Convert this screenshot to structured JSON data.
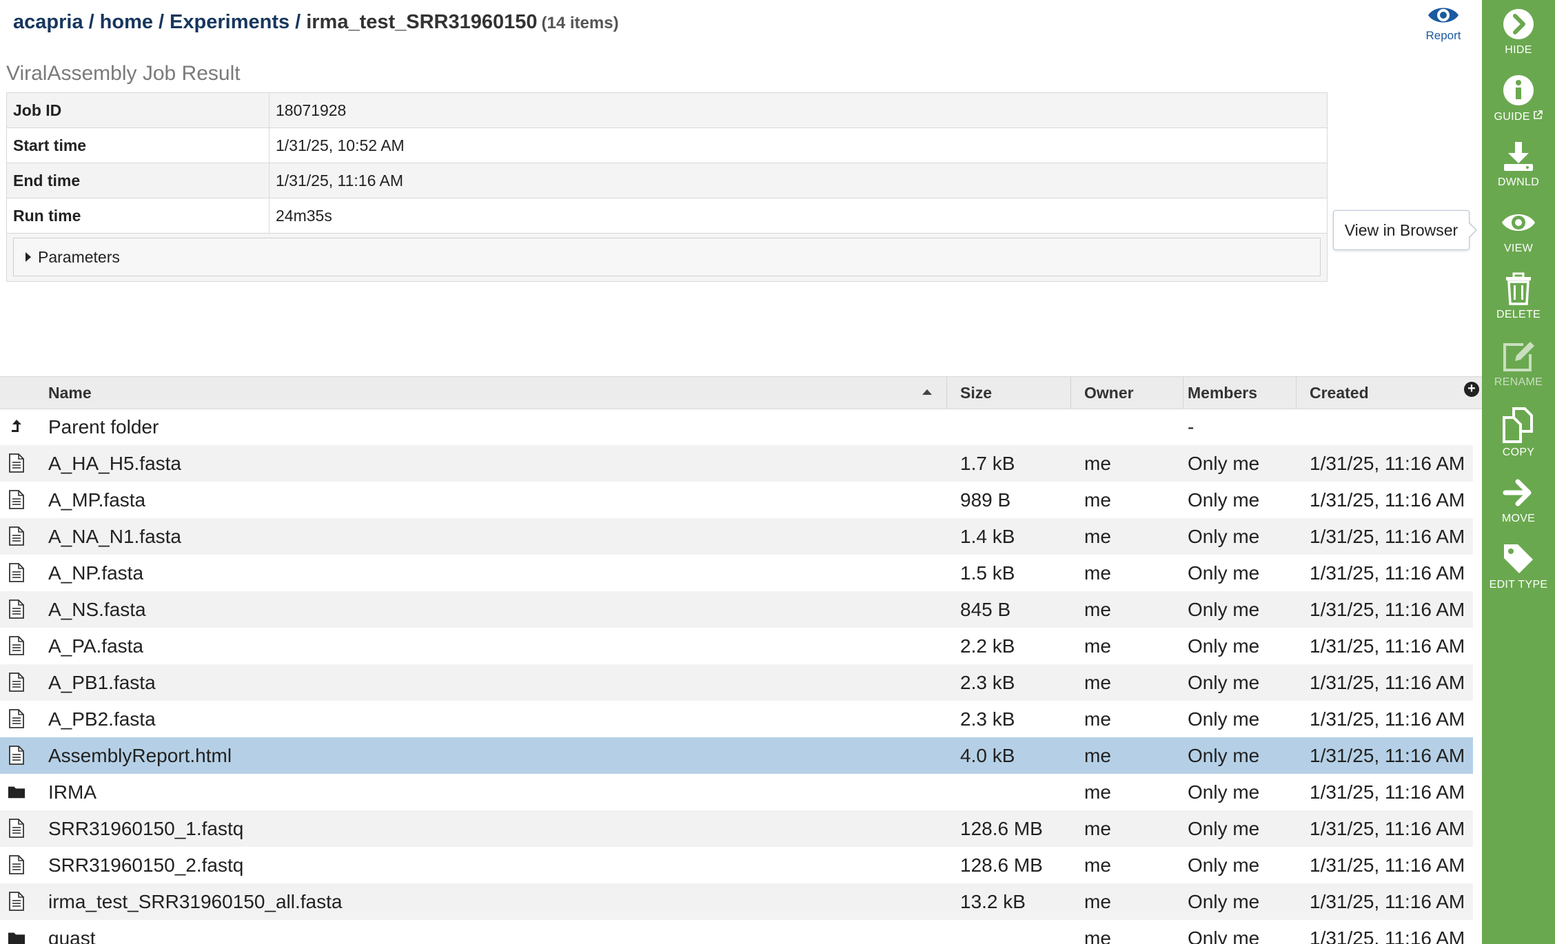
{
  "breadcrumb": {
    "root": "acapria",
    "home": "home",
    "experiments": "Experiments",
    "current": "irma_test_SRR31960150",
    "count": "(14 items)",
    "sep": "/"
  },
  "report_button": {
    "label": "Report"
  },
  "job": {
    "title": "ViralAssembly Job Result",
    "fields": [
      {
        "key": "Job ID",
        "value": "18071928"
      },
      {
        "key": "Start time",
        "value": "1/31/25, 10:52 AM"
      },
      {
        "key": "End time",
        "value": "1/31/25, 11:16 AM"
      },
      {
        "key": "Run time",
        "value": "24m35s"
      }
    ],
    "parameters_label": "Parameters"
  },
  "tooltip": {
    "text": "View in Browser"
  },
  "grid": {
    "columns": {
      "name": "Name",
      "size": "Size",
      "owner": "Owner",
      "members": "Members",
      "created": "Created"
    },
    "add_column_glyph": "+",
    "rows": [
      {
        "icon": "parent",
        "name": "Parent folder",
        "size": "",
        "owner": "",
        "members": "-",
        "created": ""
      },
      {
        "icon": "file",
        "name": "A_HA_H5.fasta",
        "size": "1.7 kB",
        "owner": "me",
        "members": "Only me",
        "created": "1/31/25, 11:16 AM"
      },
      {
        "icon": "file",
        "name": "A_MP.fasta",
        "size": "989 B",
        "owner": "me",
        "members": "Only me",
        "created": "1/31/25, 11:16 AM"
      },
      {
        "icon": "file",
        "name": "A_NA_N1.fasta",
        "size": "1.4 kB",
        "owner": "me",
        "members": "Only me",
        "created": "1/31/25, 11:16 AM"
      },
      {
        "icon": "file",
        "name": "A_NP.fasta",
        "size": "1.5 kB",
        "owner": "me",
        "members": "Only me",
        "created": "1/31/25, 11:16 AM"
      },
      {
        "icon": "file",
        "name": "A_NS.fasta",
        "size": "845 B",
        "owner": "me",
        "members": "Only me",
        "created": "1/31/25, 11:16 AM"
      },
      {
        "icon": "file",
        "name": "A_PA.fasta",
        "size": "2.2 kB",
        "owner": "me",
        "members": "Only me",
        "created": "1/31/25, 11:16 AM"
      },
      {
        "icon": "file",
        "name": "A_PB1.fasta",
        "size": "2.3 kB",
        "owner": "me",
        "members": "Only me",
        "created": "1/31/25, 11:16 AM"
      },
      {
        "icon": "file",
        "name": "A_PB2.fasta",
        "size": "2.3 kB",
        "owner": "me",
        "members": "Only me",
        "created": "1/31/25, 11:16 AM"
      },
      {
        "icon": "file",
        "name": "AssemblyReport.html",
        "size": "4.0 kB",
        "owner": "me",
        "members": "Only me",
        "created": "1/31/25, 11:16 AM",
        "selected": true
      },
      {
        "icon": "folder",
        "name": "IRMA",
        "size": "",
        "owner": "me",
        "members": "Only me",
        "created": "1/31/25, 11:16 AM"
      },
      {
        "icon": "file",
        "name": "SRR31960150_1.fastq",
        "size": "128.6 MB",
        "owner": "me",
        "members": "Only me",
        "created": "1/31/25, 11:16 AM"
      },
      {
        "icon": "file",
        "name": "SRR31960150_2.fastq",
        "size": "128.6 MB",
        "owner": "me",
        "members": "Only me",
        "created": "1/31/25, 11:16 AM"
      },
      {
        "icon": "file",
        "name": "irma_test_SRR31960150_all.fasta",
        "size": "13.2 kB",
        "owner": "me",
        "members": "Only me",
        "created": "1/31/25, 11:16 AM"
      },
      {
        "icon": "folder",
        "name": "quast",
        "size": "",
        "owner": "me",
        "members": "Only me",
        "created": "1/31/25, 11:16 AM"
      }
    ]
  },
  "sidebar": {
    "color": "#6aa84f",
    "buttons": [
      {
        "id": "hide",
        "label": "HIDE",
        "icon": "chevron-right-circle-icon"
      },
      {
        "id": "guide",
        "label": "GUIDE",
        "icon": "info-circle-icon",
        "external": true
      },
      {
        "id": "download",
        "label": "DWNLD",
        "icon": "download-icon"
      },
      {
        "id": "view",
        "label": "VIEW",
        "icon": "eye-icon"
      },
      {
        "id": "delete",
        "label": "DELETE",
        "icon": "trash-icon"
      },
      {
        "id": "rename",
        "label": "RENAME",
        "icon": "edit-icon",
        "disabled": true
      },
      {
        "id": "copy",
        "label": "COPY",
        "icon": "copy-icon"
      },
      {
        "id": "move",
        "label": "MOVE",
        "icon": "arrow-right-icon"
      },
      {
        "id": "edit-type",
        "label": "EDIT TYPE",
        "icon": "tag-icon"
      }
    ]
  }
}
